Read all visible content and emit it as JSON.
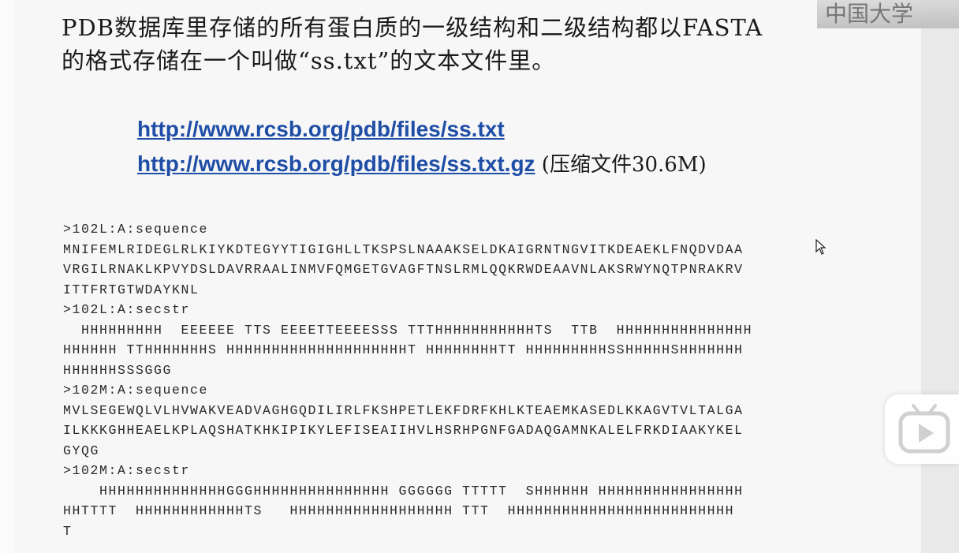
{
  "title": {
    "line1": "PDB数据库里存储的所有蛋白质的一级结构和二级结构都以FASTA",
    "line2": "的格式存储在一个叫做“ss.txt”的文本文件里。"
  },
  "links": {
    "url1": "http://www.rcsb.org/pdb/files/ss.txt",
    "url2": "http://www.rcsb.org/pdb/files/ss.txt.gz",
    "url2_note": " (压缩文件30.6M)"
  },
  "sequence_lines": [
    ">102L:A:sequence",
    "MNIFEMLRIDEGLRLKIYKDTEGYYTIGIGHLLTKSPSLNAAAKSELDKAIGRNTNGVITKDEAEKLFNQDVDAA",
    "VRGILRNAKLKPVYDSLDAVRRAALINMVFQMGETGVAGFTNSLRMLQQKRWDEAAVNLAKSRWYNQTPNRAKRV",
    "ITTFRTGTWDAYKNL",
    ">102L:A:secstr",
    "  HHHHHHHHH  EEEEEE TTS EEEETTEEEESSS TTTHHHHHHHHHHHTS  TTB  HHHHHHHHHHHHHHH",
    "HHHHHH TTHHHHHHHS HHHHHHHHHHHHHHHHHHHHT HHHHHHHHTT HHHHHHHHHSSHHHHHSHHHHHHH",
    "HHHHHHSSSGGG",
    ">102M:A:sequence",
    "MVLSEGEWQLVLHVWAKVEADVAGHGQDILIRLFKSHPETLEKFDRFKHLKTEAEMKASEDLKKAGVTVLTALGA",
    "ILKKKGHHEAELKPLAQSHATKHKIPIKYLEFISEAIIHVLHSRHPGNFGADAQGAMNKALELFRKDIAAKYKEL",
    "GYQG",
    ">102M:A:secstr",
    "    HHHHHHHHHHHHHHGGGHHHHHHHHHHHHHHH GGGGGG TTTTT  SHHHHHH HHHHHHHHHHHHHHHH",
    "HHTTTT  HHHHHHHHHHHHTS   HHHHHHHHHHHHHHHHHH TTT  HHHHHHHHHHHHHHHHHHHHHHHHH",
    "T"
  ],
  "logo_text": "中国大学",
  "icons": {
    "logo": "university-logo-icon",
    "player": "bilibili-play-icon",
    "cursor": "mouse-cursor-icon"
  }
}
